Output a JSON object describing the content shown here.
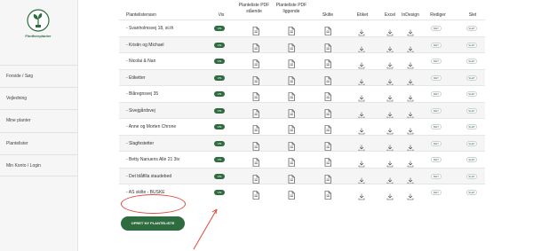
{
  "logo": {
    "text": "Findforeplanter"
  },
  "sidebar": {
    "items": [
      {
        "label": "Forside / Søg"
      },
      {
        "label": "Vejledning"
      },
      {
        "label": "Mine planter"
      },
      {
        "label": "Plantelister"
      },
      {
        "label": "Min Konto / Login"
      }
    ]
  },
  "table": {
    "headers": {
      "name": "Plantelistenavn",
      "vis": "Vis",
      "pdf_staaende": "Planteliste PDF stående",
      "pdf_liggende": "Planteliste PDF liggende",
      "skilte": "Skilte",
      "etiket": "Etiket",
      "excel": "Excel",
      "indesign": "InDesign",
      "rediger": "Rediger",
      "slet": "Slet"
    },
    "vis_label": "VIS",
    "rediger_label": "RET",
    "slet_label": "SLET",
    "rows": [
      {
        "name": "- Svanholmsvej 18, st.th"
      },
      {
        "name": "- Kristin og Michael"
      },
      {
        "name": "- Nicolai & Nan"
      },
      {
        "name": "- Etiketter"
      },
      {
        "name": "- Blåregnsvej 35"
      },
      {
        "name": "- Sivejgårdsvej"
      },
      {
        "name": "- Anne og Morten Chrone"
      },
      {
        "name": "- Slagfestetter"
      },
      {
        "name": "- Betty Nanuens Alle 21 3tv"
      },
      {
        "name": "- Det blåfilla staudebed"
      },
      {
        "name": "- AS skilte - BUSKE"
      }
    ]
  },
  "create_button": {
    "label": "OPRET NY PLANTELISTE"
  },
  "colors": {
    "accent": "#2e6b3e",
    "annotation": "#e04a3a"
  }
}
